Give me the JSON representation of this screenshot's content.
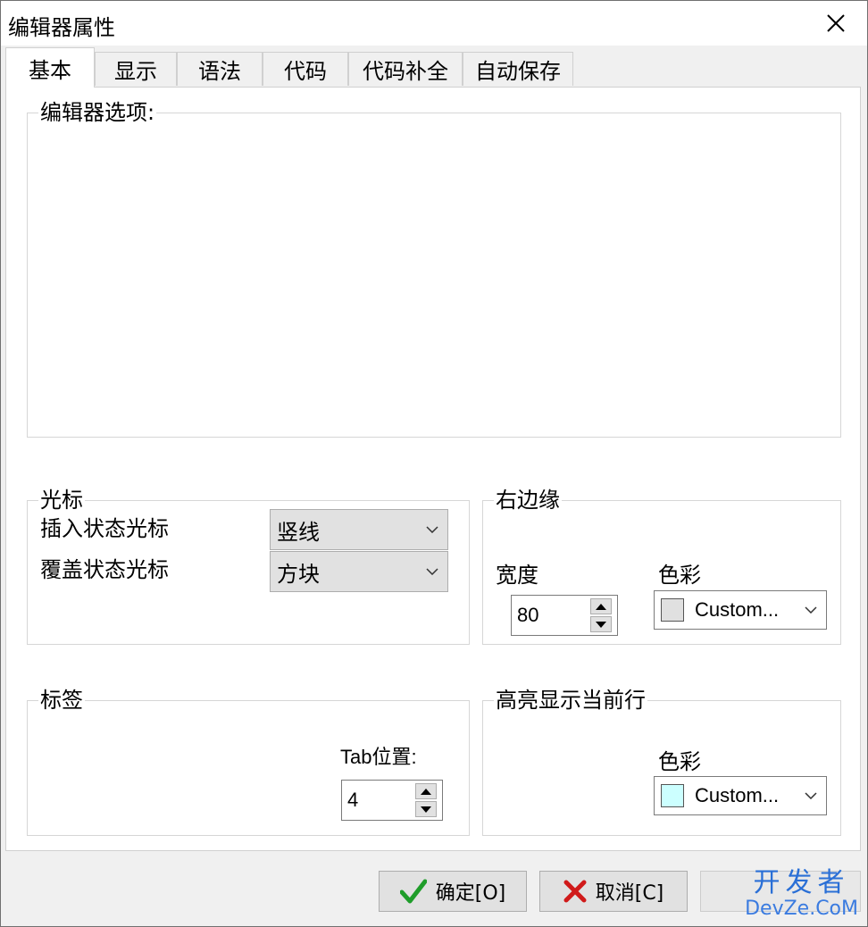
{
  "window": {
    "title": "编辑器属性"
  },
  "tabs": [
    {
      "label": "基本",
      "active": true
    },
    {
      "label": "显示"
    },
    {
      "label": "语法"
    },
    {
      "label": "代码"
    },
    {
      "label": "代码补全"
    },
    {
      "label": "自动保存"
    }
  ],
  "editor_options": {
    "label": "编辑器选项:"
  },
  "cursor": {
    "label": "光标",
    "insert_label": "插入状态光标",
    "insert_value": "竖线",
    "overwrite_label": "覆盖状态光标",
    "overwrite_value": "方块"
  },
  "right_margin": {
    "label": "右边缘",
    "width_label": "宽度",
    "width_value": "80",
    "color_label": "色彩",
    "color_value": "Custom...",
    "color_swatch": "#e0e0e0"
  },
  "tabs_group": {
    "label": "标签",
    "tab_position_label": "Tab位置:",
    "tab_position_value": "4"
  },
  "highlight": {
    "label": "高亮显示当前行",
    "color_label": "色彩",
    "color_value": "Custom...",
    "color_swatch": "#ccffff"
  },
  "buttons": {
    "ok": "确定[O]",
    "cancel": "取消[C]"
  },
  "watermark": {
    "top": "开发者",
    "bottom": "DevZe.CoM"
  }
}
